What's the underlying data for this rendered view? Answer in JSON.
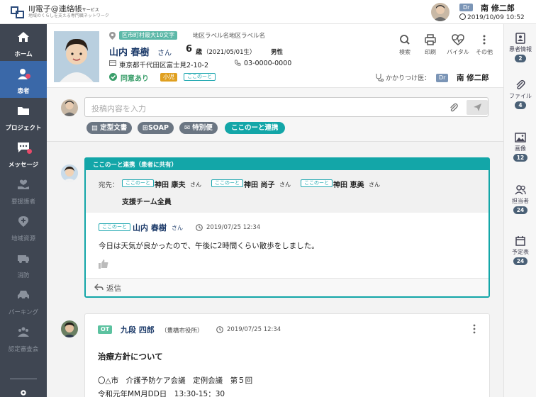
{
  "app": {
    "brand_name": "IIJ電子@連絡帳",
    "brand_service": "サービス",
    "brand_tagline": "地域のくらしを支える専門職ネットワーク"
  },
  "user": {
    "role": "Dr",
    "name": "南 修二郎",
    "datetime": "2019/10/09 10:52"
  },
  "sidebar": {
    "items": [
      {
        "label": "ホーム",
        "icon": "home-icon"
      },
      {
        "label": "患者",
        "icon": "patient-icon"
      },
      {
        "label": "プロジェクト",
        "icon": "folder-icon"
      },
      {
        "label": "メッセージ",
        "icon": "message-icon"
      },
      {
        "label": "要援護者",
        "icon": "hand-heart-icon"
      },
      {
        "label": "地域資源",
        "icon": "map-pin-plus-icon"
      },
      {
        "label": "消防",
        "icon": "ambulance-icon"
      },
      {
        "label": "パーキング",
        "icon": "car-icon"
      },
      {
        "label": "認定審査会",
        "icon": "group-icon"
      }
    ]
  },
  "patient": {
    "region_badge": "区市町村最大10文字",
    "region_labels": "地区ラベル名地区ラベル名",
    "name": "山内 春樹",
    "honorific": "さん",
    "age": "6",
    "age_unit": "歳",
    "birth": "（2021/05/01生）",
    "sex": "男性",
    "address": "東京都千代田区富士見2-10-2",
    "phone": "03-0000-0000",
    "consent": "同意あり",
    "tag_pediatric": "小児",
    "tag_service": "ここのーと",
    "doctor_label": "かかりつけ医：",
    "doctor_role": "Dr",
    "doctor_name": "南 修二郎"
  },
  "actions": [
    {
      "label": "検索",
      "icon": "search-icon"
    },
    {
      "label": "印刷",
      "icon": "printer-icon"
    },
    {
      "label": "バイタル",
      "icon": "vital-heart-icon"
    },
    {
      "label": "その他",
      "icon": "more-vertical-icon"
    }
  ],
  "right_rail": [
    {
      "label": "患者情報",
      "count": "2",
      "icon": "patient-info-icon"
    },
    {
      "label": "ファイル",
      "count": "4",
      "icon": "paperclip-icon"
    },
    {
      "label": "画像",
      "count": "12",
      "icon": "image-icon"
    },
    {
      "label": "担当者",
      "count": "24",
      "icon": "staff-icon"
    },
    {
      "label": "予定表",
      "count": "24",
      "icon": "calendar-icon"
    }
  ],
  "composer": {
    "placeholder": "投稿内容を入力",
    "chips": [
      "定型文書",
      "SOAP",
      "特別便",
      "ここのーと連携"
    ]
  },
  "posts": [
    {
      "header": "ここのーと連携（患者に共有）",
      "to_label": "宛先：",
      "recipients": [
        {
          "tag": "ここのーと",
          "name": "神田 康夫",
          "suffix": "さん"
        },
        {
          "tag": "ここのーと",
          "name": "神田 尚子",
          "suffix": "さん"
        },
        {
          "tag": "ここのーと",
          "name": "神田 恵美",
          "suffix": "さん"
        }
      ],
      "team": "支援チーム全員",
      "author_tag": "ここのーと",
      "author": "山内 春樹",
      "author_suffix": "さん",
      "time": "2019/07/25 12:34",
      "body": "今日は天気が良かったので、午後に2時間くらい散歩をしました。",
      "reply": "返信"
    },
    {
      "author_tag": "OT",
      "author": "九段 四郎",
      "org": "（豊橋市役所）",
      "time": "2019/07/25 12:34",
      "title": "治療方針について",
      "line1": "〇△市　介護予防ケア会議　定例会議　第５回",
      "line2": "令和元年MM月DD日　13:30-15：30"
    }
  ],
  "colors": {
    "sidebar": "#3f4652",
    "active": "#3a68a8",
    "teal": "#13a6a8",
    "badge_dot": "#e84b6a"
  }
}
